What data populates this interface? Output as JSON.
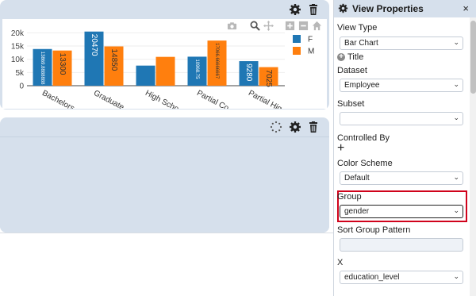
{
  "chart_panel": {
    "icons": [
      "gear-icon",
      "trash-icon"
    ],
    "modebar": [
      "camera-icon",
      "zoom-icon",
      "pan-icon",
      "zoom-in-icon",
      "zoom-out-icon",
      "home-icon"
    ]
  },
  "chart_data": {
    "type": "bar",
    "categories": [
      "Bachelors",
      "Graduate",
      "High School",
      "Partial College",
      "Partial High School"
    ],
    "tick_labels": [
      "Bachelors",
      "Graduate",
      "High Scho",
      "Partial Co",
      "Partial Hig"
    ],
    "series": [
      {
        "name": "F",
        "color": "#1f77b4",
        "values": [
          13869.88,
          20470,
          7600,
          10968.75,
          9280
        ],
        "value_labels": [
          "13869.8888888",
          "20470",
          "",
          "10968.75",
          "9280"
        ]
      },
      {
        "name": "M",
        "color": "#ff7f0e",
        "values": [
          13300,
          14850,
          10900,
          17066.67,
          7025
        ],
        "value_labels": [
          "13300",
          "14850",
          "",
          "17066.66666667",
          "7025"
        ]
      }
    ],
    "ylim": [
      0,
      21000
    ],
    "yticks": [
      "0",
      "5k",
      "10k",
      "15k",
      "20k"
    ],
    "ytick_values": [
      0,
      5000,
      10000,
      15000,
      20000
    ],
    "legend_position": "top-right"
  },
  "empty_panel": {
    "icons": [
      "spinner-icon",
      "gear-icon",
      "trash-icon"
    ]
  },
  "props": {
    "title": "View Properties",
    "close": "×",
    "view_type_label": "View Type",
    "view_type_value": "Bar Chart",
    "title_add": "Title",
    "dataset_label": "Dataset",
    "dataset_value": "Employee",
    "subset_label": "Subset",
    "subset_value": "",
    "controlled_by_label": "Controlled By",
    "controlled_by_add": "+",
    "color_scheme_label": "Color Scheme",
    "color_scheme_value": "Default",
    "group_label": "Group",
    "group_value": "gender",
    "sort_group_label": "Sort Group Pattern",
    "sort_group_value": "",
    "x_label": "X",
    "x_value": "education_level"
  }
}
